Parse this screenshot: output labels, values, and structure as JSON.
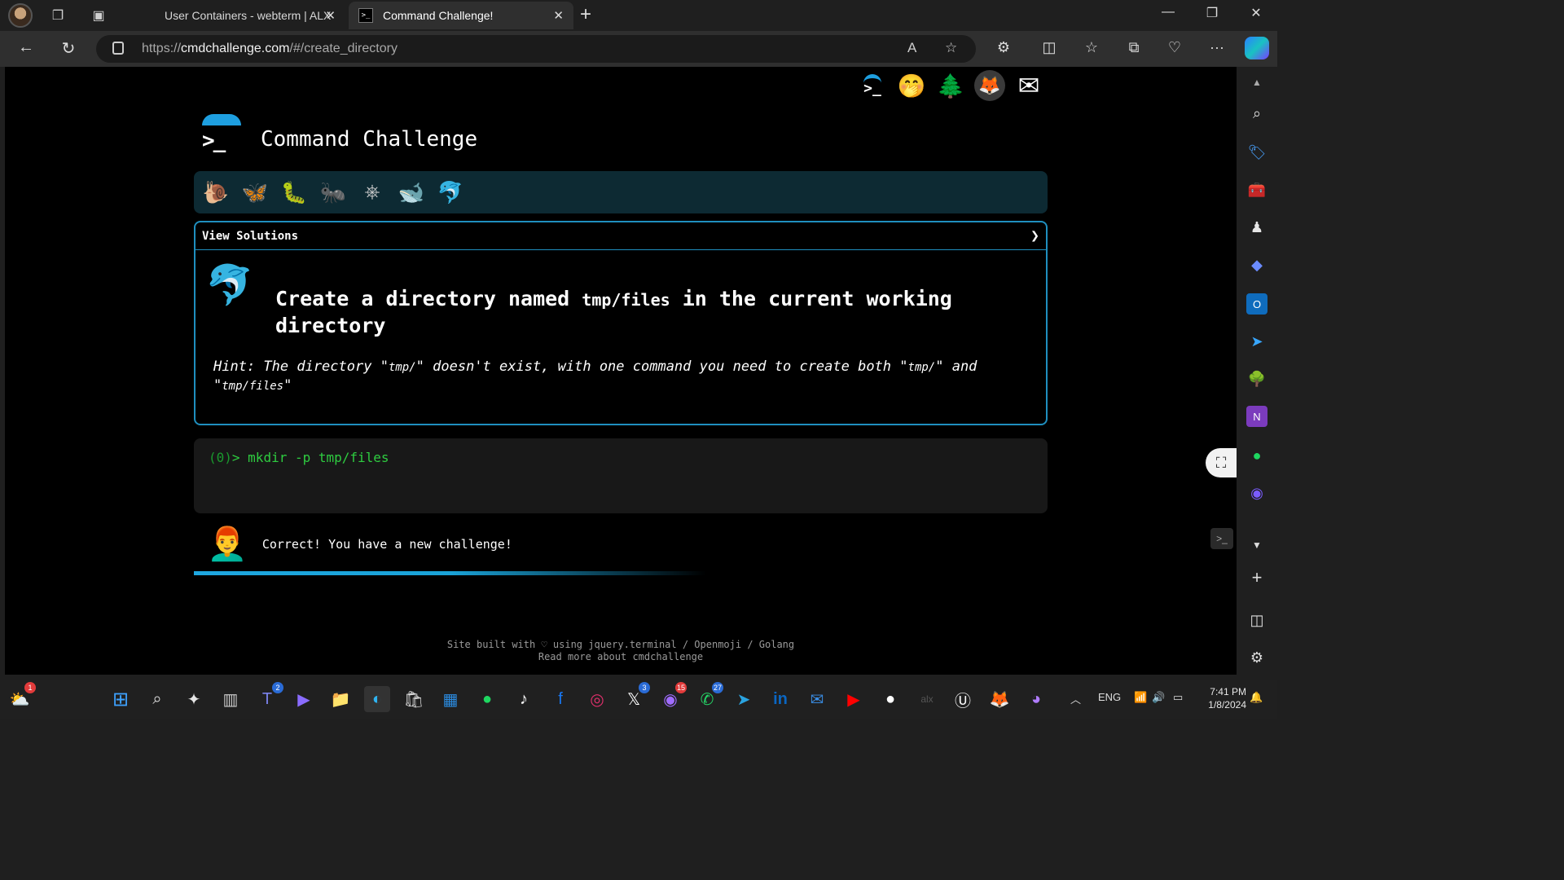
{
  "browser": {
    "tabs": [
      {
        "title": "User Containers - webterm | ALX",
        "active": false
      },
      {
        "title": "Command Challenge!",
        "active": true
      }
    ],
    "url_prefix": "https://",
    "url_host": "cmdchallenge.com",
    "url_path": "/#/create_directory"
  },
  "page": {
    "logo_prompt": ">_",
    "site_title": "Command Challenge",
    "top_icons": [
      "terminal-logo-icon",
      "face-hand-icon",
      "tree-icon",
      "gitlab-icon",
      "envelope-icon"
    ],
    "levels": [
      {
        "name": "snail-icon",
        "glyph": "🐌"
      },
      {
        "name": "butterfly-icon",
        "glyph": "🦋"
      },
      {
        "name": "caterpillar-icon",
        "glyph": "🐛"
      },
      {
        "name": "ant-icon",
        "glyph": "🐜"
      },
      {
        "name": "kubernetes-icon",
        "glyph": "⎈"
      },
      {
        "name": "whale-icon",
        "glyph": "🐋"
      },
      {
        "name": "dolphin-icon",
        "glyph": "🐬"
      }
    ],
    "solutions_label": "View Solutions",
    "challenge_pre": "Create a directory named ",
    "challenge_code": "tmp/files",
    "challenge_post": " in the current working directory",
    "hint_pre": "Hint: The directory \"",
    "hint_code1": "tmp/",
    "hint_mid": "\" doesn't exist, with one command you need to create both \"",
    "hint_code2": "tmp/",
    "hint_mid2": "\" and \"",
    "hint_code3": "tmp/files",
    "hint_post": "\"",
    "terminal_num": "(0)",
    "terminal_prompt": "> ",
    "terminal_command": "mkdir -p tmp/files",
    "result_text": "Correct! You have a new challenge!",
    "progress": 0.6,
    "footer_line1": "Site built with ♡ using jquery.terminal / Openmoji / Golang",
    "footer_line2": "Read more about cmdchallenge"
  },
  "taskbar": {
    "badges": {
      "weather": "1",
      "teams": "2",
      "x": "3",
      "messenger": "15",
      "whatsapp": "27"
    },
    "lang": "ENG",
    "time": "7:41 PM",
    "date": "1/8/2024"
  },
  "colors": {
    "accent": "#1e9fe0",
    "terminal_green": "#2ecc40",
    "level_bar": "#0d2a33"
  }
}
